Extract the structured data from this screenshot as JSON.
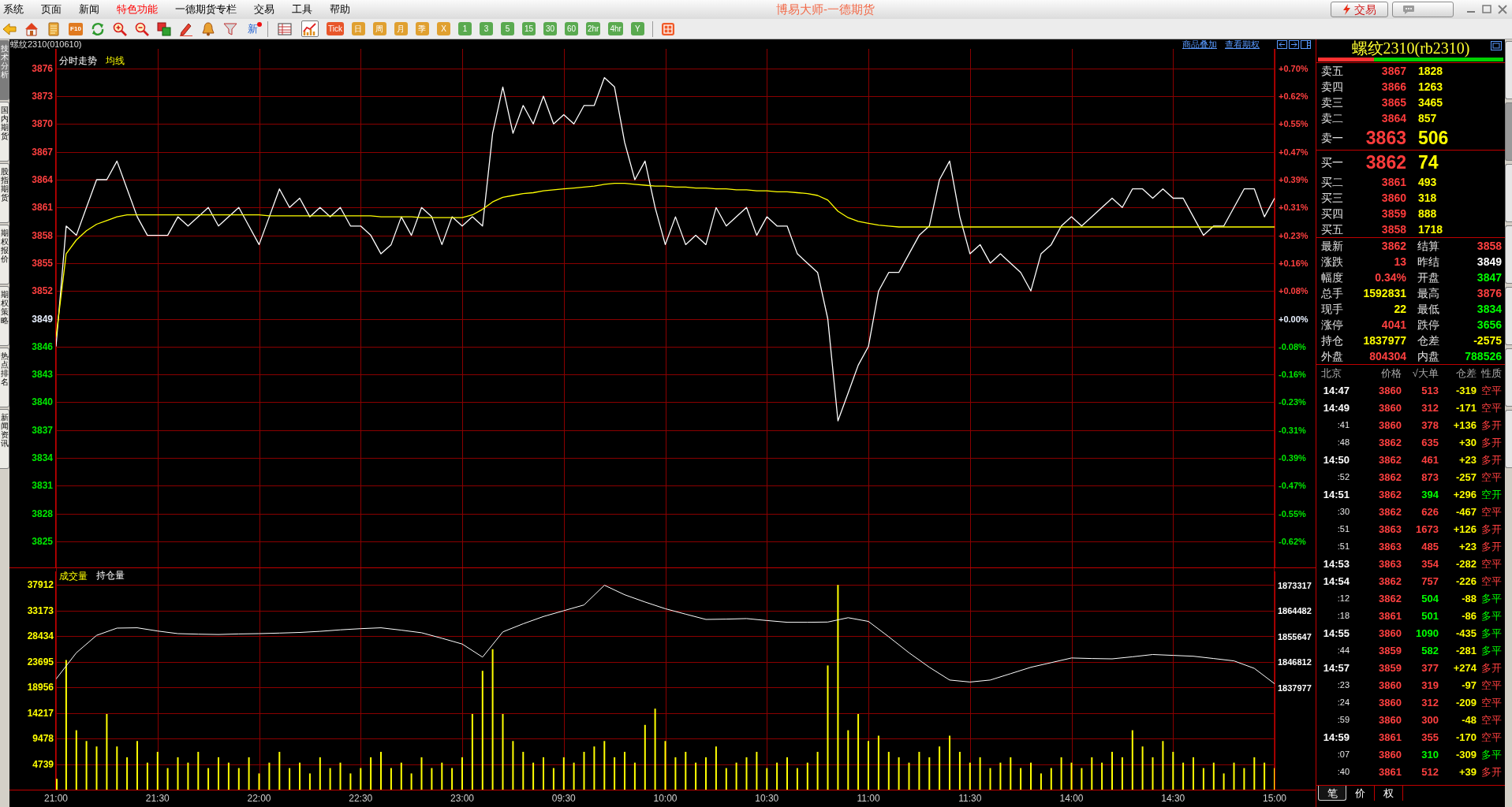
{
  "menu": [
    {
      "label": "系统",
      "highlighted": false
    },
    {
      "label": "页面",
      "highlighted": false
    },
    {
      "label": "新闻",
      "highlighted": false
    },
    {
      "label": "特色功能",
      "highlighted": true
    },
    {
      "label": "一德期货专栏",
      "highlighted": false
    },
    {
      "label": "交易",
      "highlighted": false
    },
    {
      "label": "工具",
      "highlighted": false
    },
    {
      "label": "帮助",
      "highlighted": false
    }
  ],
  "app_title": "博易大师-一德期货",
  "trade_button": {
    "label": "交易"
  },
  "toolbar": {
    "f10_label": "F10",
    "news_label": "新",
    "view_buttons": [
      {
        "selected": false
      },
      {
        "selected": true
      }
    ],
    "periods": [
      {
        "label": "Tick",
        "color": "#e8562a"
      },
      {
        "label": "日",
        "color": "#e0a030"
      },
      {
        "label": "周",
        "color": "#e0a030"
      },
      {
        "label": "月",
        "color": "#e0a030"
      },
      {
        "label": "季",
        "color": "#e0a030"
      },
      {
        "label": "X",
        "color": "#e0a030"
      },
      {
        "label": "1",
        "color": "#5aaa50"
      },
      {
        "label": "3",
        "color": "#5aaa50"
      },
      {
        "label": "5",
        "color": "#5aaa50"
      },
      {
        "label": "15",
        "color": "#5aaa50"
      },
      {
        "label": "30",
        "color": "#5aaa50"
      },
      {
        "label": "60",
        "color": "#5aaa50"
      },
      {
        "label": "2hr",
        "color": "#5aaa50"
      },
      {
        "label": "4hr",
        "color": "#5aaa50"
      },
      {
        "label": "Y",
        "color": "#5aaa50"
      }
    ]
  },
  "side_tabs": [
    {
      "label": "技术分析",
      "selected": true
    },
    {
      "label": "国内期货",
      "selected": false
    },
    {
      "label": "股指期货",
      "selected": false
    },
    {
      "label": "期权报价",
      "selected": false
    },
    {
      "label": "期权策略",
      "selected": false
    },
    {
      "label": "热点排名",
      "selected": false
    },
    {
      "label": "新闻资讯",
      "selected": false
    }
  ],
  "right_tabs": [
    {
      "selected": false
    },
    {
      "selected": true
    },
    {
      "selected": false
    },
    {
      "selected": false
    },
    {
      "selected": false
    },
    {
      "selected": false
    },
    {
      "selected": false
    }
  ],
  "chart_header": {
    "symbol": "螺纹2310(010610)",
    "links": [
      "商品叠加",
      "查看期权"
    ]
  },
  "price_chart": {
    "chart_data": {
      "type": "line",
      "grid": true,
      "categories": [
        null,
        null,
        null,
        null,
        null,
        null,
        null,
        null,
        null,
        null,
        null,
        null,
        null,
        null,
        null,
        null,
        null,
        null,
        null,
        null,
        null,
        null,
        null,
        null,
        null,
        null,
        null,
        null,
        null,
        null,
        null,
        null,
        null,
        null,
        null,
        null,
        null,
        null,
        null,
        null,
        null,
        null,
        null,
        null,
        null,
        null,
        null,
        null,
        null,
        null,
        null,
        null,
        null,
        null,
        null,
        null,
        null,
        null,
        null,
        null,
        null,
        null,
        null,
        null,
        null,
        null,
        null,
        null,
        null,
        null,
        null,
        null,
        null,
        null,
        null,
        null,
        null,
        null,
        null,
        null,
        null,
        null,
        null,
        null,
        null,
        null,
        null,
        null,
        null,
        null,
        null,
        null,
        null,
        null,
        null,
        null,
        null,
        null,
        null,
        null,
        null,
        null,
        null,
        null,
        null,
        null,
        null,
        null,
        null,
        null,
        null,
        null,
        null,
        null,
        null,
        null,
        null,
        null,
        null,
        null,
        null
      ],
      "ylim": [
        3822.2,
        3878.1
      ],
      "yticks": [
        3876,
        3873,
        3870,
        3867,
        3864,
        3861,
        3858,
        3855,
        3852,
        3849,
        3846,
        3843,
        3840,
        3837,
        3834,
        3831,
        3828,
        3825
      ],
      "series": [
        {
          "name": "分时走势",
          "color": "#ffffff",
          "values": [
            3846,
            3859,
            3858,
            3861,
            3864,
            3864,
            3866,
            3863,
            3860,
            3858,
            3858,
            3858,
            3860,
            3859,
            3860,
            3861,
            3859,
            3860,
            3861,
            3859,
            3857,
            3860,
            3863,
            3861,
            3862,
            3860,
            3861,
            3860,
            3861,
            3859,
            3859,
            3858,
            3856,
            3857,
            3860,
            3858,
            3861,
            3860,
            3857,
            3860,
            3859,
            3860,
            3859,
            3869,
            3874,
            3869,
            3872,
            3870,
            3873,
            3870,
            3871,
            3870,
            3872,
            3872,
            3875,
            3874,
            3868,
            3864,
            3866,
            3861,
            3857,
            3860,
            3857,
            3858,
            3857,
            3861,
            3859,
            3860,
            3861,
            3858,
            3860,
            3859,
            3859,
            3856,
            3855,
            3854,
            3849,
            3838,
            3841,
            3844,
            3846,
            3852,
            3854,
            3854,
            3856,
            3858,
            3859,
            3864,
            3866,
            3860,
            3856,
            3857,
            3855,
            3856,
            3855,
            3854,
            3852,
            3856,
            3857,
            3859,
            3860,
            3859,
            3860,
            3861,
            3862,
            3861,
            3863,
            3863,
            3862,
            3863,
            3862,
            3862,
            3860,
            3858,
            3859,
            3859,
            3861,
            3863,
            3863,
            3860,
            3862
          ]
        },
        {
          "name": "均线",
          "color": "#ffff00",
          "values": [
            3847,
            3856,
            3857.5,
            3858.5,
            3859.2,
            3859.6,
            3860,
            3860.2,
            3860.2,
            3860.2,
            3860.2,
            3860.2,
            3860.2,
            3860.2,
            3860.2,
            3860.2,
            3860.2,
            3860.2,
            3860.2,
            3860.2,
            3860.2,
            3860.1,
            3860.1,
            3860.1,
            3860.1,
            3860.1,
            3860.1,
            3860.1,
            3860.1,
            3860.1,
            3860.1,
            3860.1,
            3860,
            3860,
            3860,
            3860,
            3859.9,
            3859.9,
            3859.9,
            3859.9,
            3859.9,
            3860.2,
            3860.8,
            3861.6,
            3862.1,
            3862.3,
            3862.5,
            3862.6,
            3862.8,
            3862.9,
            3863,
            3863.1,
            3863.2,
            3863.3,
            3863.5,
            3863.6,
            3863.6,
            3863.5,
            3863.4,
            3863.3,
            3863.3,
            3863.2,
            3863.2,
            3863.1,
            3863.1,
            3863,
            3863,
            3862.9,
            3862.9,
            3862.8,
            3862.8,
            3862.7,
            3862.7,
            3862.6,
            3862.5,
            3862.3,
            3861.8,
            3860.6,
            3859.9,
            3859.5,
            3859.3,
            3859.1,
            3859,
            3858.9,
            3858.9,
            3858.9,
            3858.9,
            3858.9,
            3858.9,
            3858.9,
            3858.9,
            3858.9,
            3858.9,
            3858.9,
            3858.9,
            3858.9,
            3858.9,
            3858.9,
            3858.9,
            3858.9,
            3858.9,
            3858.9,
            3858.9,
            3858.9,
            3858.9,
            3858.9,
            3858.9,
            3858.9,
            3858.9,
            3858.9,
            3858.9,
            3858.9,
            3858.9,
            3858.9,
            3858.9,
            3858.9,
            3858.9,
            3858.9,
            3858.9,
            3858.9,
            3858.9
          ]
        }
      ]
    },
    "right_axis": [
      {
        "label": "+0.70%",
        "kind": "up"
      },
      {
        "label": "+0.62%",
        "kind": "up"
      },
      {
        "label": "+0.55%",
        "kind": "up"
      },
      {
        "label": "+0.47%",
        "kind": "up"
      },
      {
        "label": "+0.39%",
        "kind": "up"
      },
      {
        "label": "+0.31%",
        "kind": "up"
      },
      {
        "label": "+0.23%",
        "kind": "up"
      },
      {
        "label": "+0.16%",
        "kind": "up"
      },
      {
        "label": "+0.08%",
        "kind": "up"
      },
      {
        "label": "+0.00%",
        "kind": "flat"
      },
      {
        "label": "-0.08%",
        "kind": "down"
      },
      {
        "label": "-0.16%",
        "kind": "down"
      },
      {
        "label": "-0.23%",
        "kind": "down"
      },
      {
        "label": "-0.31%",
        "kind": "down"
      },
      {
        "label": "-0.39%",
        "kind": "down"
      },
      {
        "label": "-0.47%",
        "kind": "down"
      },
      {
        "label": "-0.55%",
        "kind": "down"
      },
      {
        "label": "-0.62%",
        "kind": "down"
      }
    ]
  },
  "volume_chart": {
    "chart_data": {
      "type": "bar",
      "grid": true,
      "categories": [
        "21:00",
        null,
        null,
        null,
        null,
        null,
        null,
        null,
        null,
        null,
        "21:30",
        null,
        null,
        null,
        null,
        null,
        null,
        null,
        null,
        null,
        "22:00",
        null,
        null,
        null,
        null,
        null,
        null,
        null,
        null,
        null,
        "22:30",
        null,
        null,
        null,
        null,
        null,
        null,
        null,
        null,
        null,
        "23:00",
        null,
        null,
        null,
        null,
        null,
        null,
        null,
        null,
        null,
        "09:30",
        null,
        null,
        null,
        null,
        null,
        null,
        null,
        null,
        null,
        "10:00",
        null,
        null,
        null,
        null,
        null,
        null,
        null,
        null,
        null,
        "10:30",
        null,
        null,
        null,
        null,
        null,
        null,
        null,
        null,
        null,
        "11:00",
        null,
        null,
        null,
        null,
        null,
        null,
        null,
        null,
        null,
        "11:30",
        null,
        null,
        null,
        null,
        null,
        null,
        null,
        null,
        null,
        "14:00",
        null,
        null,
        null,
        null,
        null,
        null,
        null,
        null,
        null,
        "14:30",
        null,
        null,
        null,
        null,
        null,
        null,
        null,
        null,
        null,
        "15:00"
      ],
      "ylim": [
        0,
        41000
      ],
      "yticks": [
        37912,
        33173,
        28434,
        23695,
        18956,
        14217,
        9478,
        4739
      ],
      "series": [
        {
          "name": "成交量",
          "color": "#ffff00",
          "values": [
            2000,
            24000,
            11000,
            9000,
            8000,
            14000,
            8000,
            6000,
            9000,
            5000,
            7000,
            4000,
            6000,
            5000,
            7000,
            4000,
            6000,
            5000,
            4000,
            6000,
            3000,
            5000,
            7000,
            4000,
            5000,
            3000,
            6000,
            4000,
            5000,
            3000,
            4000,
            6000,
            7000,
            4000,
            5000,
            3000,
            6000,
            4000,
            5000,
            4000,
            6000,
            14000,
            22000,
            26000,
            14000,
            9000,
            7000,
            5000,
            6000,
            4000,
            6000,
            5000,
            7000,
            8000,
            9000,
            6000,
            7000,
            5000,
            12000,
            15000,
            9000,
            6000,
            7000,
            5000,
            6000,
            8000,
            4000,
            5000,
            6000,
            7000,
            4000,
            5000,
            6000,
            4000,
            5000,
            7000,
            23000,
            37900,
            11000,
            14000,
            9000,
            10000,
            7000,
            6000,
            5000,
            7000,
            6000,
            8000,
            10000,
            7000,
            5000,
            6000,
            4000,
            5000,
            6000,
            4000,
            5000,
            3000,
            4000,
            6000,
            5000,
            4000,
            6000,
            5000,
            7000,
            6000,
            11000,
            8000,
            6000,
            9000,
            7000,
            5000,
            6000,
            4000,
            5000,
            3000,
            5000,
            4000,
            6000,
            5000,
            4000
          ]
        }
      ]
    }
  },
  "open_interest_chart": {
    "chart_data": {
      "type": "line",
      "categories": [
        null,
        null,
        null,
        null,
        null,
        null,
        null,
        null,
        null,
        null,
        null,
        null,
        null,
        null,
        null,
        null,
        null,
        null,
        null,
        null,
        null,
        null,
        null,
        null,
        null,
        null,
        null,
        null,
        null,
        null,
        null,
        null,
        null,
        null,
        null,
        null,
        null,
        null,
        null,
        null,
        null,
        null,
        null,
        null,
        null,
        null,
        null,
        null,
        null,
        null,
        null,
        null,
        null,
        null,
        null,
        null,
        null,
        null,
        null,
        null,
        null
      ],
      "ylim": [
        1837977,
        1873317
      ],
      "yticks": [
        1873317,
        1864482,
        1855647,
        1846812,
        1837977
      ],
      "series": [
        {
          "name": "持仓量",
          "color": "#ffffff",
          "values": [
            1840900,
            1850000,
            1856000,
            1858500,
            1858600,
            1857500,
            1856600,
            1856400,
            1856300,
            1856500,
            1856600,
            1856800,
            1857000,
            1857400,
            1857900,
            1858300,
            1858600,
            1857800,
            1856900,
            1855000,
            1853000,
            1848500,
            1857200,
            1860000,
            1862500,
            1864500,
            1866500,
            1873300,
            1870000,
            1867500,
            1865200,
            1863300,
            1861500,
            1861600,
            1861800,
            1861100,
            1860500,
            1860500,
            1860600,
            1862100,
            1860800,
            1855500,
            1850000,
            1845000,
            1840600,
            1839900,
            1840600,
            1842800,
            1845000,
            1846600,
            1848200,
            1848000,
            1847900,
            1848600,
            1849400,
            1849100,
            1848800,
            1848000,
            1847200,
            1844600,
            1839300
          ]
        }
      ]
    }
  },
  "quote_panel": {
    "title": "螺纹2310(rb2310)",
    "ratio": {
      "level": 0.3
    },
    "asks": [
      {
        "label": "卖五",
        "price": "3867",
        "volume": "1828",
        "kind": "depth"
      },
      {
        "label": "卖四",
        "price": "3866",
        "volume": "1263",
        "kind": "depth"
      },
      {
        "label": "卖三",
        "price": "3865",
        "volume": "3465",
        "kind": "depth"
      },
      {
        "label": "卖二",
        "price": "3864",
        "volume": "857",
        "kind": "depth"
      },
      {
        "label": "卖一",
        "price": "3863",
        "volume": "506",
        "kind": "best"
      }
    ],
    "bids": [
      {
        "label": "买一",
        "price": "3862",
        "volume": "74",
        "kind": "best"
      },
      {
        "label": "买二",
        "price": "3861",
        "volume": "493",
        "kind": "depth"
      },
      {
        "label": "买三",
        "price": "3860",
        "volume": "318",
        "kind": "depth"
      },
      {
        "label": "买四",
        "price": "3859",
        "volume": "888",
        "kind": "depth"
      },
      {
        "label": "买五",
        "price": "3858",
        "volume": "1718",
        "kind": "depth"
      }
    ],
    "stats": [
      {
        "label": "最新",
        "value": "3862",
        "color": "#ff4040"
      },
      {
        "label": "结算",
        "value": "3858",
        "color": "#ff4040"
      },
      {
        "label": "涨跌",
        "value": "13",
        "color": "#ff4040"
      },
      {
        "label": "昨结",
        "value": "3849",
        "color": "#ffffff"
      },
      {
        "label": "幅度",
        "value": "0.34%",
        "color": "#ff4040"
      },
      {
        "label": "开盘",
        "value": "3847",
        "color": "#00ff00"
      },
      {
        "label": "总手",
        "value": "1592831",
        "color": "#ffff00"
      },
      {
        "label": "最高",
        "value": "3876",
        "color": "#ff4040"
      },
      {
        "label": "现手",
        "value": "22",
        "color": "#ffff00"
      },
      {
        "label": "最低",
        "value": "3834",
        "color": "#00ff00"
      },
      {
        "label": "涨停",
        "value": "4041",
        "color": "#ff4040"
      },
      {
        "label": "跌停",
        "value": "3656",
        "color": "#00ff00"
      },
      {
        "label": "持仓",
        "value": "1837977",
        "color": "#ffff00"
      },
      {
        "label": "仓差",
        "value": "-2575",
        "color": "#ffff00"
      },
      {
        "label": "外盘",
        "value": "804304",
        "color": "#ff4040"
      },
      {
        "label": "内盘",
        "value": "788526",
        "color": "#00ff00"
      }
    ]
  },
  "trades": {
    "columns": [
      "北京",
      "价格",
      "√大单",
      "仓差",
      "性质"
    ],
    "rows": [
      {
        "time": "14:47",
        "kind": "minute",
        "price": "3860",
        "volume": "513",
        "change": "-319",
        "nature": "空平",
        "color": "#ff4040"
      },
      {
        "time": "14:49",
        "kind": "minute",
        "price": "3860",
        "volume": "312",
        "change": "-171",
        "nature": "空平",
        "color": "#ff4040"
      },
      {
        "time": ":41",
        "kind": "second",
        "price": "3860",
        "volume": "378",
        "change": "+136",
        "nature": "多开",
        "color": "#ff4040"
      },
      {
        "time": ":48",
        "kind": "second",
        "price": "3862",
        "volume": "635",
        "change": "+30",
        "nature": "多开",
        "color": "#ff4040"
      },
      {
        "time": "14:50",
        "kind": "minute",
        "price": "3862",
        "volume": "461",
        "change": "+23",
        "nature": "多开",
        "color": "#ff4040"
      },
      {
        "time": ":52",
        "kind": "second",
        "price": "3862",
        "volume": "873",
        "change": "-257",
        "nature": "空平",
        "color": "#ff4040"
      },
      {
        "time": "14:51",
        "kind": "minute",
        "price": "3862",
        "volume": "394",
        "change": "+296",
        "nature": "空开",
        "color": "#00ff00"
      },
      {
        "time": ":30",
        "kind": "second",
        "price": "3862",
        "volume": "626",
        "change": "-467",
        "nature": "空平",
        "color": "#ff4040"
      },
      {
        "time": ":51",
        "kind": "second",
        "price": "3863",
        "volume": "1673",
        "change": "+126",
        "nature": "多开",
        "color": "#ff4040"
      },
      {
        "time": ":51",
        "kind": "second",
        "price": "3863",
        "volume": "485",
        "change": "+23",
        "nature": "多开",
        "color": "#ff4040"
      },
      {
        "time": "14:53",
        "kind": "minute",
        "price": "3863",
        "volume": "354",
        "change": "-282",
        "nature": "空平",
        "color": "#ff4040"
      },
      {
        "time": "14:54",
        "kind": "minute",
        "price": "3862",
        "volume": "757",
        "change": "-226",
        "nature": "空平",
        "color": "#ff4040"
      },
      {
        "time": ":12",
        "kind": "second",
        "price": "3862",
        "volume": "504",
        "change": "-88",
        "nature": "多平",
        "color": "#00ff00"
      },
      {
        "time": ":18",
        "kind": "second",
        "price": "3861",
        "volume": "501",
        "change": "-86",
        "nature": "多平",
        "color": "#00ff00"
      },
      {
        "time": "14:55",
        "kind": "minute",
        "price": "3860",
        "volume": "1090",
        "change": "-435",
        "nature": "多平",
        "color": "#00ff00"
      },
      {
        "time": ":44",
        "kind": "second",
        "price": "3859",
        "volume": "582",
        "change": "-281",
        "nature": "多平",
        "color": "#00ff00"
      },
      {
        "time": "14:57",
        "kind": "minute",
        "price": "3859",
        "volume": "377",
        "change": "+274",
        "nature": "多开",
        "color": "#ff4040"
      },
      {
        "time": ":23",
        "kind": "second",
        "price": "3860",
        "volume": "319",
        "change": "-97",
        "nature": "空平",
        "color": "#ff4040"
      },
      {
        "time": ":24",
        "kind": "second",
        "price": "3860",
        "volume": "312",
        "change": "-209",
        "nature": "空平",
        "color": "#ff4040"
      },
      {
        "time": ":59",
        "kind": "second",
        "price": "3860",
        "volume": "300",
        "change": "-48",
        "nature": "空平",
        "color": "#ff4040"
      },
      {
        "time": "14:59",
        "kind": "minute",
        "price": "3861",
        "volume": "355",
        "change": "-170",
        "nature": "空平",
        "color": "#ff4040"
      },
      {
        "time": ":07",
        "kind": "second",
        "price": "3860",
        "volume": "310",
        "change": "-309",
        "nature": "多平",
        "color": "#00ff00"
      },
      {
        "time": ":40",
        "kind": "second",
        "price": "3861",
        "volume": "512",
        "change": "+39",
        "nature": "多开",
        "color": "#ff4040"
      }
    ],
    "tabs": [
      {
        "label": "笔",
        "selected": true
      },
      {
        "label": "价",
        "selected": false
      },
      {
        "label": "权",
        "selected": false
      }
    ]
  }
}
